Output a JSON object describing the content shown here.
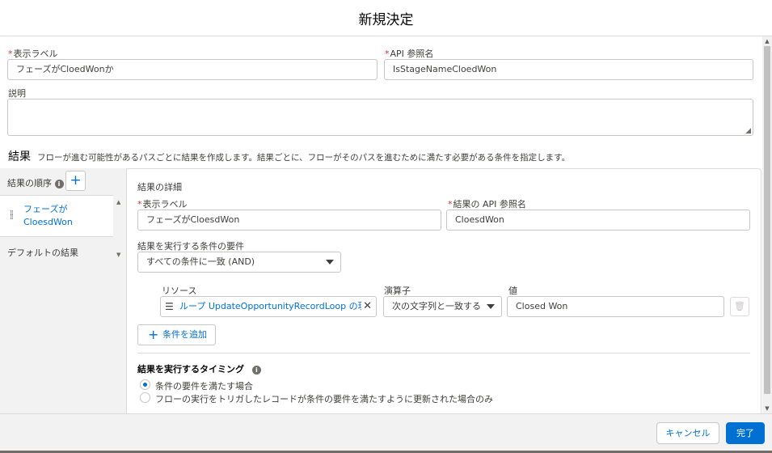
{
  "modal": {
    "title": "新規決定"
  },
  "form": {
    "label_caption": "表示ラベル",
    "label_value": "フェーズがCloedWonか",
    "api_caption": "API 参照名",
    "api_value": "IsStageNameCloedWon",
    "description_caption": "説明",
    "description_value": ""
  },
  "outcomes": {
    "title": "結果",
    "description": "フローが進む可能性があるパスごとに結果を作成します。結果ごとに、フローがそのパスを進むために満たす必要がある条件を指定します。",
    "sidebar": {
      "order_label": "結果の順序",
      "add_symbol": "+",
      "selected_item": "フェーズが CloesdWon",
      "default_item": "デフォルトの結果"
    },
    "detail": {
      "heading": "結果の詳細",
      "label_caption": "表示ラベル",
      "label_value": "フェーズがCloesdWon",
      "api_caption": "結果の API 参照名",
      "api_value": "CloesdWon",
      "condition_req_caption": "結果を実行する条件の要件",
      "condition_req_value": "すべての条件に一致 (AND)",
      "resource_caption": "リソース",
      "resource_value": "ループ UpdateOpportunityRecordLoop の現在…",
      "operator_caption": "演算子",
      "operator_value": "次の文字列と一致する",
      "value_caption": "値",
      "value_value": "Closed Won",
      "add_condition": "条件を追加",
      "timing_heading": "結果を実行するタイミング",
      "timing_options": [
        {
          "label": "条件の要件を満たす場合",
          "selected": true
        },
        {
          "label": "フローの実行をトリガしたレコードが条件の要件を満たすように更新された場合のみ",
          "selected": false
        }
      ]
    }
  },
  "footer": {
    "cancel": "キャンセル",
    "done": "完了"
  },
  "colors": {
    "brand": "#0070d2",
    "required": "#c23934"
  }
}
